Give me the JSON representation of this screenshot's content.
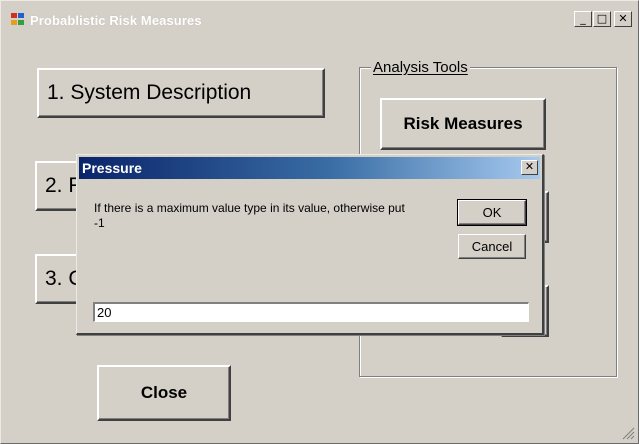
{
  "window": {
    "title": "Probablistic Risk Measures",
    "minimize_label": "_",
    "maximize_label": "□",
    "close_label": "✕"
  },
  "main": {
    "step_buttons": [
      {
        "label": "1. System Description"
      },
      {
        "label": "2. F"
      },
      {
        "label": "3. C"
      }
    ],
    "close_button": "Close"
  },
  "analysis_tools": {
    "label": "Analysis Tools",
    "risk_measures_button": "Risk Measures"
  },
  "dialog": {
    "title": "Pressure",
    "close_label": "✕",
    "prompt": "If there is a maximum value type in its value, otherwise put -1",
    "ok_label": "OK",
    "cancel_label": "Cancel",
    "input_value": "20"
  },
  "colors": {
    "face": "#d4d0c8",
    "dialog_title_start": "#0a246a",
    "dialog_title_end": "#a6caf0"
  }
}
